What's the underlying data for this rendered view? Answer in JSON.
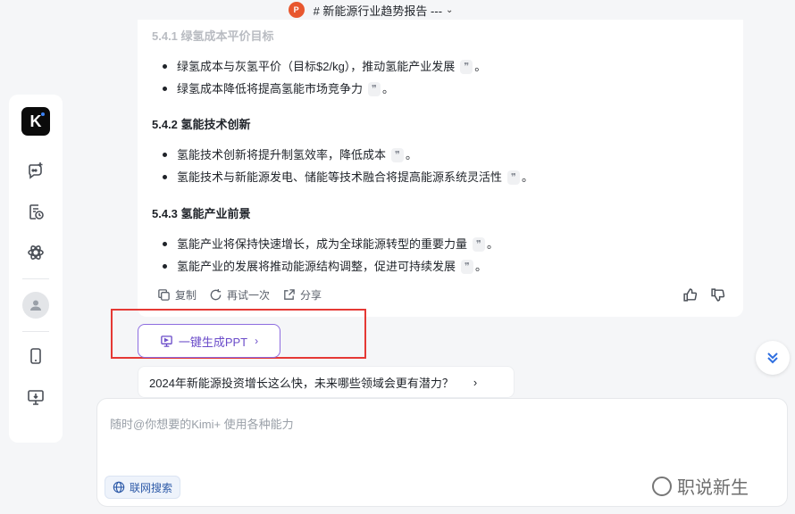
{
  "topbar": {
    "badge": "P",
    "title": "# 新能源行业趋势报告 ---",
    "chevron": "⌄"
  },
  "sidebar": {
    "logo": "K"
  },
  "card": {
    "section_541": "5.4.1 绿氢成本平价目标",
    "list1": [
      "绿氢成本与灰氢平价（目标$2/kg），推动氢能产业发展",
      "绿氢成本降低将提高氢能市场竞争力"
    ],
    "section_542": "5.4.2 氢能技术创新",
    "list2": [
      "氢能技术创新将提升制氢效率，降低成本",
      "氢能技术与新能源发电、储能等技术融合将提高能源系统灵活性"
    ],
    "section_543": "5.4.3 氢能产业前景",
    "list3": [
      "氢能产业将保持快速增长，成为全球能源转型的重要力量",
      "氢能产业的发展将推动能源结构调整，促进可持续发展"
    ],
    "cite_mark": "❞",
    "period": "。",
    "actions": {
      "copy": "复制",
      "retry": "再试一次",
      "share": "分享"
    }
  },
  "ppt_button": {
    "label": "一键生成PPT",
    "arrow": "›"
  },
  "suggestion": {
    "text": "2024年新能源投资增长这么快，未来哪些领域会更有潜力？",
    "arrow": "›"
  },
  "input": {
    "placeholder": "随时@你想要的Kimi+ 使用各种能力",
    "web_search": "联网搜索"
  },
  "watermark": "职说新生"
}
